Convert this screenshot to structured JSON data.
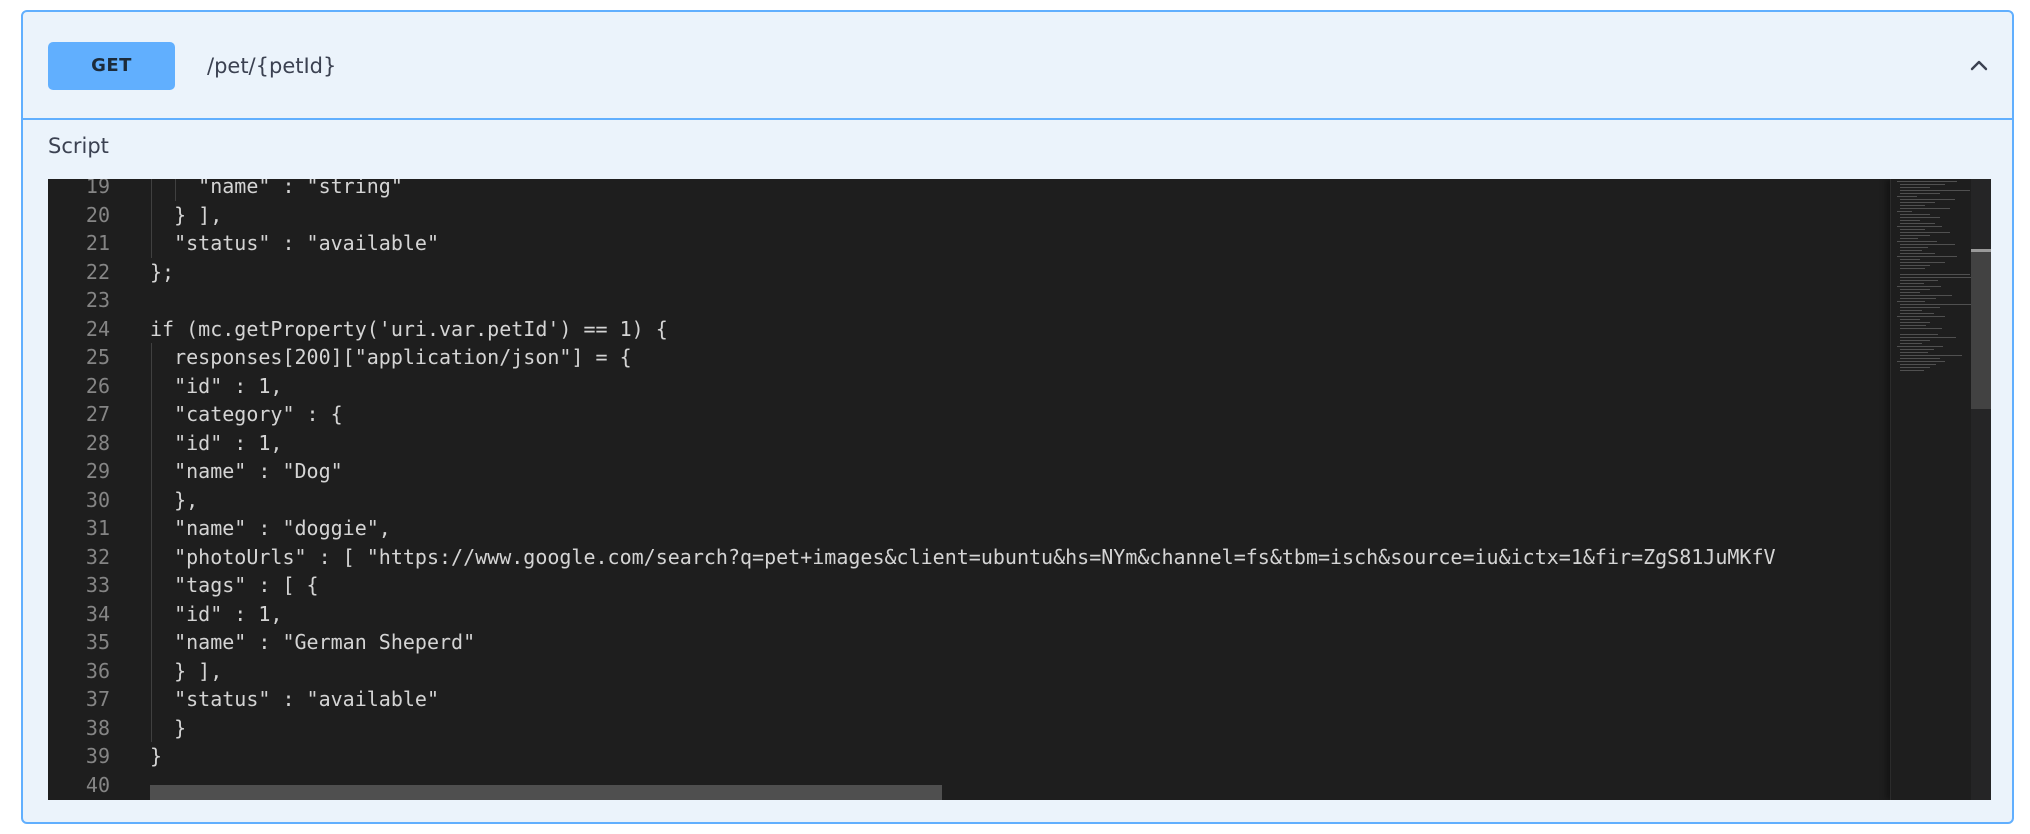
{
  "operation": {
    "method": "GET",
    "path": "/pet/{petId}",
    "expanded": true,
    "accent_color": "#61affe",
    "collapse_icon": "chevron-up-icon"
  },
  "script_section": {
    "label": "Script"
  },
  "editor": {
    "theme": "dark",
    "background": "#1e1e1e",
    "lines": [
      {
        "num": "19",
        "text": "    \"name\" : \"string\""
      },
      {
        "num": "20",
        "text": "  } ],"
      },
      {
        "num": "21",
        "text": "  \"status\" : \"available\""
      },
      {
        "num": "22",
        "text": "};"
      },
      {
        "num": "23",
        "text": ""
      },
      {
        "num": "24",
        "text": "if (mc.getProperty('uri.var.petId') == 1) {"
      },
      {
        "num": "25",
        "text": "  responses[200][\"application/json\"] = {"
      },
      {
        "num": "26",
        "text": "  \"id\" : 1,"
      },
      {
        "num": "27",
        "text": "  \"category\" : {"
      },
      {
        "num": "28",
        "text": "  \"id\" : 1,"
      },
      {
        "num": "29",
        "text": "  \"name\" : \"Dog\""
      },
      {
        "num": "30",
        "text": "  },"
      },
      {
        "num": "31",
        "text": "  \"name\" : \"doggie\","
      },
      {
        "num": "32",
        "text": "  \"photoUrls\" : [ \"https://www.google.com/search?q=pet+images&client=ubuntu&hs=NYm&channel=fs&tbm=isch&source=iu&ictx=1&fir=ZgS81JuMKfV"
      },
      {
        "num": "33",
        "text": "  \"tags\" : [ {"
      },
      {
        "num": "34",
        "text": "  \"id\" : 1,"
      },
      {
        "num": "35",
        "text": "  \"name\" : \"German Sheperd\""
      },
      {
        "num": "36",
        "text": "  } ],"
      },
      {
        "num": "37",
        "text": "  \"status\" : \"available\""
      },
      {
        "num": "38",
        "text": "  }"
      },
      {
        "num": "39",
        "text": "}"
      },
      {
        "num": "40",
        "text": ""
      }
    ]
  }
}
